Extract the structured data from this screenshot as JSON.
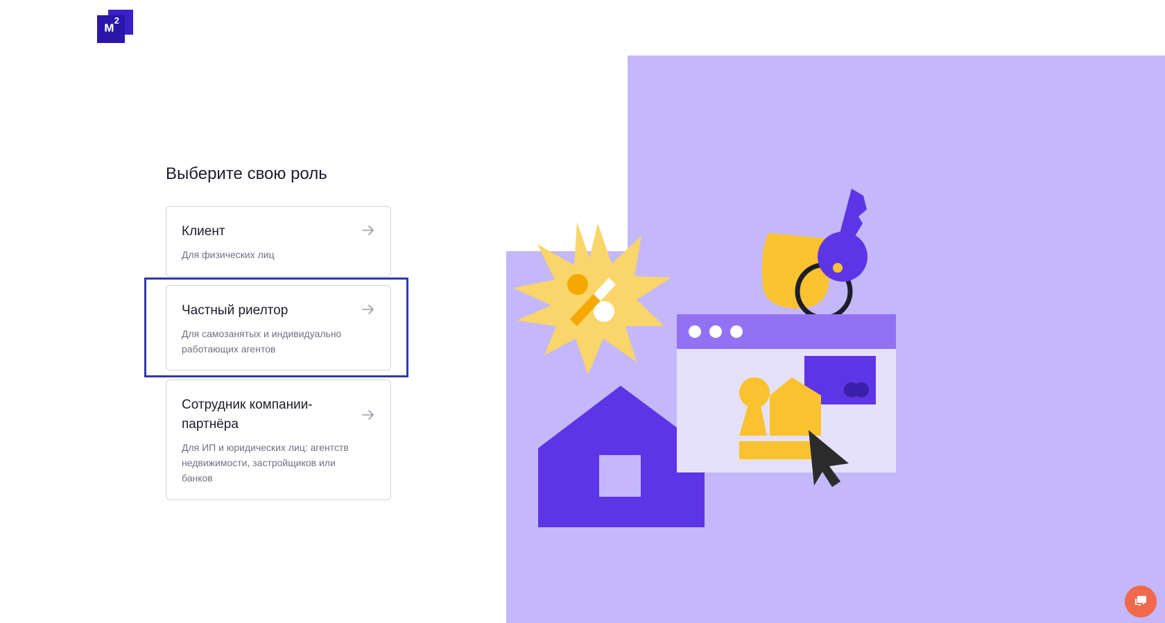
{
  "logo": {
    "letter": "м",
    "superscript": "2"
  },
  "heading": "Выберите свою роль",
  "roles": [
    {
      "title": "Клиент",
      "description": "Для физических лиц"
    },
    {
      "title": "Частный риелтор",
      "description": "Для самозанятых и индивидуально работающих агентов"
    },
    {
      "title": "Сотрудник компании-партнёра",
      "description": "Для ИП и юридических лиц: агентств недвижимости, застройщиков или банков"
    }
  ],
  "icons": {
    "arrow": "arrow-right-icon",
    "chat": "chat-icon"
  },
  "colors": {
    "brand": "#2a16a8",
    "illustration_bg": "#c4b8fb",
    "accent_purple": "#5e35e6",
    "accent_yellow": "#f9c22e",
    "chat_button": "#f0694d",
    "highlight_border": "#2e3aa8"
  }
}
